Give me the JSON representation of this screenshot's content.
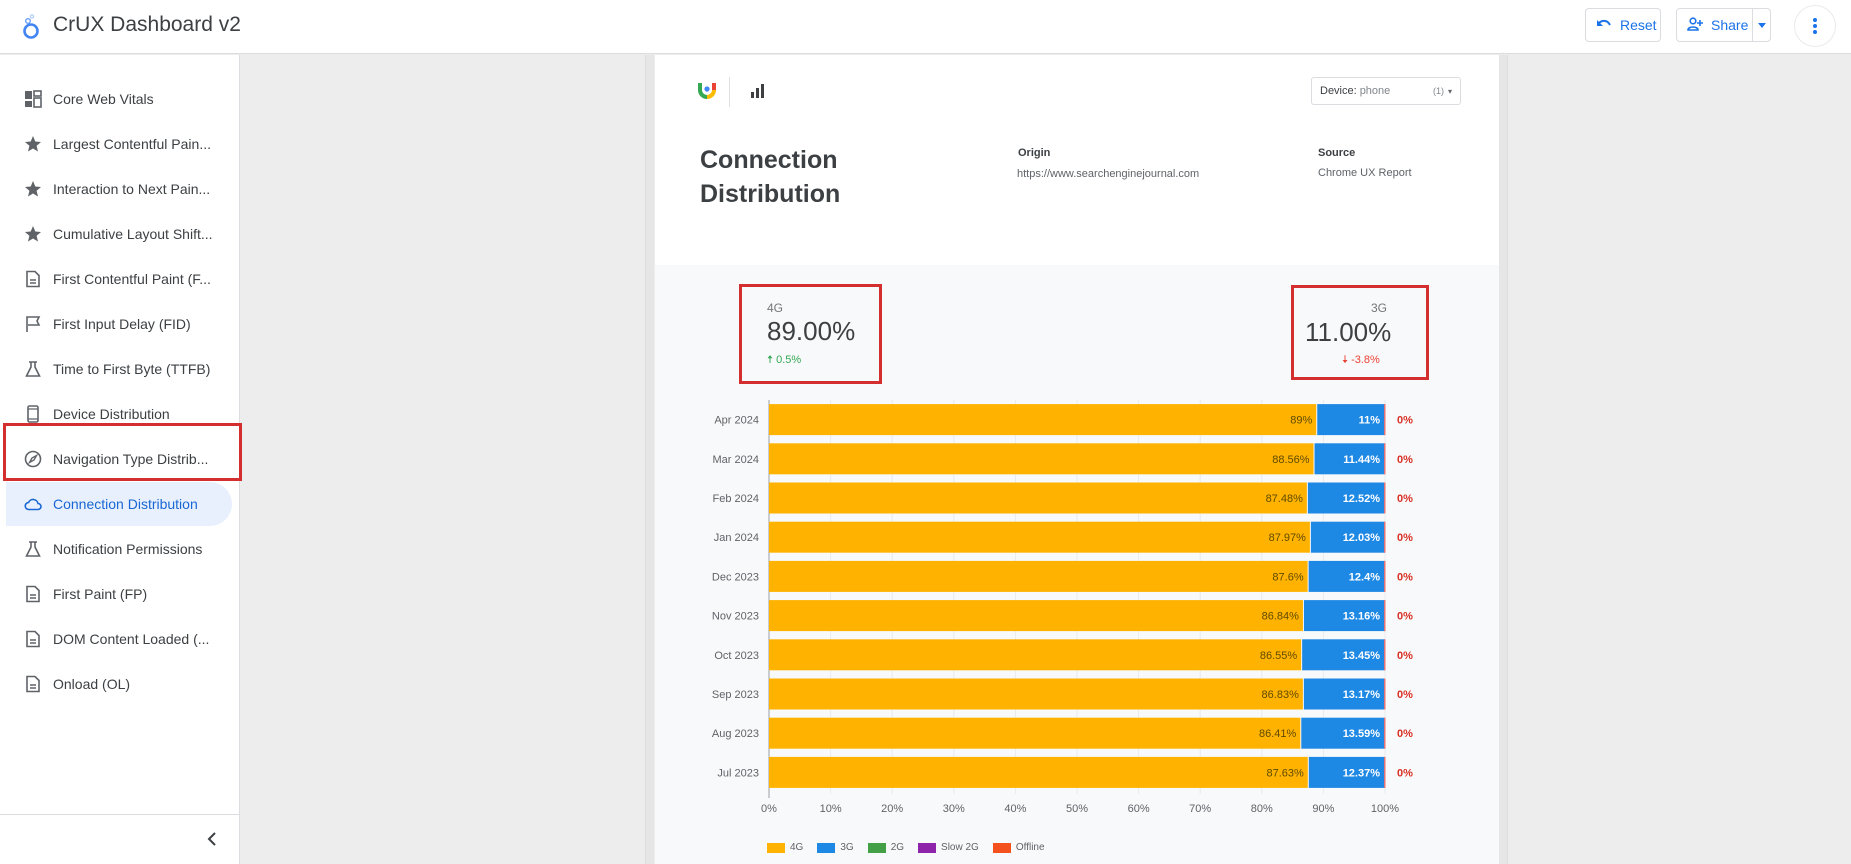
{
  "app": {
    "title": "CrUX Dashboard v2",
    "logo_icon": "looker-studio-icon",
    "reset_label": "Reset",
    "share_label": "Share",
    "more_icon": "more-vert-icon"
  },
  "sidebar": {
    "items": [
      {
        "label": "Core Web Vitals",
        "icon": "dashboard-icon",
        "active": false
      },
      {
        "label": "Largest Contentful Pain...",
        "icon": "star-icon",
        "active": false
      },
      {
        "label": "Interaction to Next Pain...",
        "icon": "star-icon",
        "active": false
      },
      {
        "label": "Cumulative Layout Shift...",
        "icon": "star-icon",
        "active": false
      },
      {
        "label": "First Contentful Paint (F...",
        "icon": "document-icon",
        "active": false
      },
      {
        "label": "First Input Delay (FID)",
        "icon": "flag-icon",
        "active": false
      },
      {
        "label": "Time to First Byte (TTFB)",
        "icon": "flask-icon",
        "active": false
      },
      {
        "label": "Device Distribution",
        "icon": "phone-icon",
        "active": false
      },
      {
        "label": "Navigation Type Distrib...",
        "icon": "compass-icon",
        "active": false
      },
      {
        "label": "Connection Distribution",
        "icon": "cloud-icon",
        "active": true
      },
      {
        "label": "Notification Permissions",
        "icon": "flask-icon",
        "active": false
      },
      {
        "label": "First Paint (FP)",
        "icon": "document-icon",
        "active": false
      },
      {
        "label": "DOM Content Loaded (...",
        "icon": "document-icon",
        "active": false
      },
      {
        "label": "Onload (OL)",
        "icon": "document-icon",
        "active": false
      }
    ]
  },
  "report": {
    "title_line1": "Connection",
    "title_line2": "Distribution",
    "origin_label": "Origin",
    "origin_value": "https://www.searchenginejournal.com",
    "source_label": "Source",
    "source_value": "Chrome UX Report",
    "device_filter": {
      "label": "Device:",
      "value": "phone",
      "count": "(1)"
    },
    "scorecards": [
      {
        "label": "4G",
        "value": "89.00%",
        "delta": "0.5%",
        "direction": "up"
      },
      {
        "label": "3G",
        "value": "11.00%",
        "delta": "-3.8%",
        "direction": "down"
      }
    ]
  },
  "colors": {
    "4G": "#ffb300",
    "3G": "#1e88e5",
    "2G": "#43a047",
    "Slow 2G": "#8e24aa",
    "Offline": "#f4511e",
    "accent": "#1a73e8",
    "highlight": "#d32f2f"
  },
  "chart_data": {
    "type": "bar",
    "orientation": "horizontal-stacked-100",
    "categories": [
      "Apr 2024",
      "Mar 2024",
      "Feb 2024",
      "Jan 2024",
      "Dec 2023",
      "Nov 2023",
      "Oct 2023",
      "Sep 2023",
      "Aug 2023",
      "Jul 2023"
    ],
    "series": [
      {
        "name": "4G",
        "values": [
          89,
          88.56,
          87.48,
          87.97,
          87.6,
          86.84,
          86.55,
          86.83,
          86.41,
          87.63
        ],
        "labels": [
          "89%",
          "88.56%",
          "87.48%",
          "87.97%",
          "87.6%",
          "86.84%",
          "86.55%",
          "86.83%",
          "86.41%",
          "87.63%"
        ]
      },
      {
        "name": "3G",
        "values": [
          11,
          11.44,
          12.52,
          12.03,
          12.4,
          13.16,
          13.45,
          13.17,
          13.59,
          12.37
        ],
        "labels": [
          "11%",
          "11.44%",
          "12.52%",
          "12.03%",
          "12.4%",
          "13.16%",
          "13.45%",
          "13.17%",
          "13.59%",
          "12.37%"
        ]
      },
      {
        "name": "2G",
        "values": [
          0,
          0,
          0,
          0,
          0,
          0,
          0,
          0,
          0,
          0
        ]
      },
      {
        "name": "Slow 2G",
        "values": [
          0,
          0,
          0,
          0,
          0,
          0,
          0,
          0,
          0,
          0
        ]
      },
      {
        "name": "Offline",
        "values": [
          0,
          0,
          0,
          0,
          0,
          0,
          0,
          0,
          0,
          0
        ],
        "labels": [
          "0%",
          "0%",
          "0%",
          "0%",
          "0%",
          "0%",
          "0%",
          "0%",
          "0%",
          "0%"
        ]
      }
    ],
    "xticks": [
      "0%",
      "10%",
      "20%",
      "30%",
      "40%",
      "50%",
      "60%",
      "70%",
      "80%",
      "90%",
      "100%"
    ],
    "xlim": [
      0,
      100
    ],
    "grid": true,
    "legend": [
      "4G",
      "3G",
      "2G",
      "Slow 2G",
      "Offline"
    ],
    "legend_position": "bottom-left"
  }
}
